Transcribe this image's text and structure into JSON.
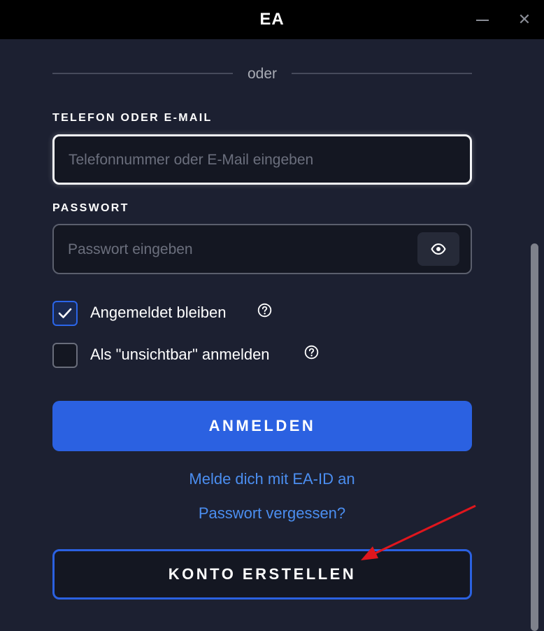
{
  "window": {
    "title": "EA",
    "minimize_icon": "minimize-icon",
    "close_icon": "close-icon",
    "close_glyph": "✕"
  },
  "divider": {
    "text": "oder"
  },
  "email": {
    "label": "TELEFON ODER E-MAIL",
    "placeholder": "Telefonnummer oder E-Mail eingeben",
    "value": ""
  },
  "password": {
    "label": "PASSWORT",
    "placeholder": "Passwort eingeben",
    "value": "",
    "toggle_icon": "eye-icon"
  },
  "options": {
    "stay_signed_in": {
      "label": "Angemeldet bleiben",
      "checked": true,
      "help_icon": "help-circle-icon"
    },
    "invisible": {
      "label": "Als \"unsichtbar\" anmelden",
      "checked": false,
      "help_icon": "help-circle-icon"
    }
  },
  "actions": {
    "sign_in": "ANMELDEN",
    "ea_id_link": "Melde dich mit EA-ID an",
    "forgot_password": "Passwort vergessen?",
    "create_account": "KONTO ERSTELLEN"
  },
  "colors": {
    "background": "#1c2031",
    "titlebar": "#000000",
    "primary": "#2b61e1",
    "link": "#4b8ef0",
    "annotation_arrow": "#e0161d"
  }
}
